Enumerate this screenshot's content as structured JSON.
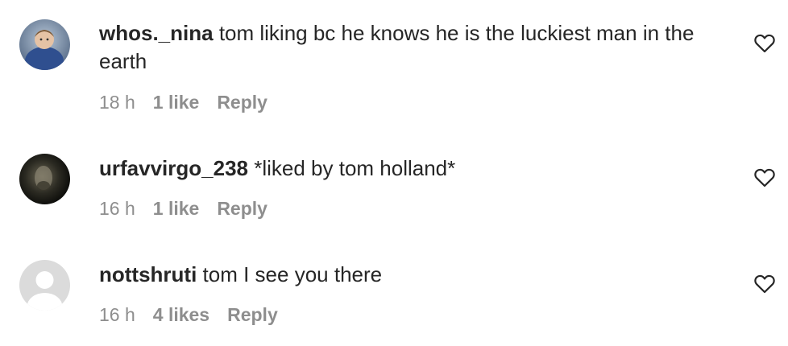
{
  "comments": [
    {
      "username": "whos._nina",
      "text": "tom liking bc he knows he is the luckiest man in the earth",
      "time": "18 h",
      "likes": "1 like",
      "reply": "Reply",
      "avatar_icon": "user-photo-avatar",
      "like_icon": "heart-outline-icon"
    },
    {
      "username": "urfavvirgo_238",
      "text": "*liked by tom holland*",
      "time": "16 h",
      "likes": "1 like",
      "reply": "Reply",
      "avatar_icon": "user-photo-avatar",
      "like_icon": "heart-outline-icon"
    },
    {
      "username": "nottshruti",
      "text": "tom I see you there",
      "time": "16 h",
      "likes": "4 likes",
      "reply": "Reply",
      "avatar_icon": "default-user-avatar",
      "like_icon": "heart-outline-icon"
    }
  ],
  "colors": {
    "text": "#262626",
    "secondary": "#8e8e8e",
    "placeholder_avatar_bg": "#dbdbdb"
  }
}
